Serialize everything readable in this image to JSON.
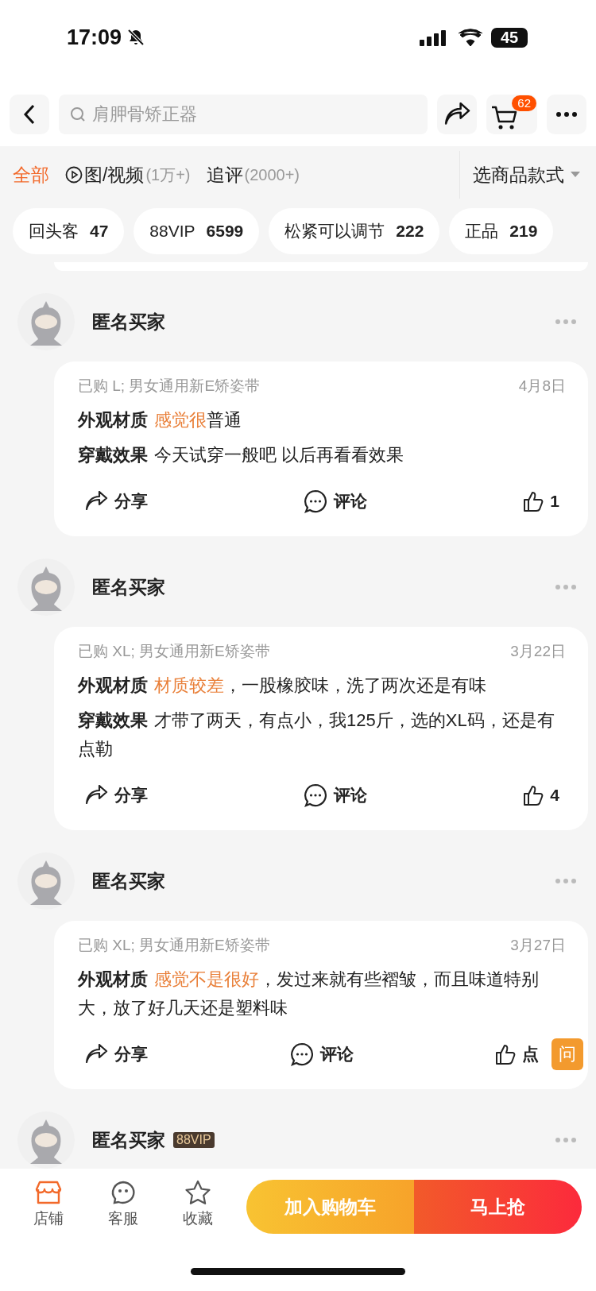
{
  "status_bar": {
    "time": "17:09",
    "battery": "45"
  },
  "nav": {
    "search": {
      "placeholder": "肩胛骨矫正器"
    },
    "cart_badge": "62"
  },
  "filters": {
    "tabs": [
      {
        "label": "全部",
        "selected": true
      },
      {
        "label": "图/视频",
        "count": "(1万+)",
        "selected": false,
        "kind": "media"
      },
      {
        "label": "追评",
        "count": "(2000+)",
        "selected": false
      }
    ],
    "style_picker": "选商品款式"
  },
  "tags": [
    {
      "label": "回头客",
      "count": "47"
    },
    {
      "label": "88VIP",
      "count": "6599"
    },
    {
      "label": "松紧可以调节",
      "count": "222"
    },
    {
      "label": "正品",
      "count": "219"
    }
  ],
  "reviews": [
    {
      "name": "匿名买家",
      "variant": "已购 L; 男女通用新E矫姿带",
      "date": "4月8日",
      "lines": [
        {
          "label": "外观材质",
          "highlight": "感觉很",
          "text": "普通"
        },
        {
          "label": "穿戴效果",
          "text": "今天试穿一般吧 以后再看看效果"
        }
      ],
      "share": "分享",
      "comment": "评论",
      "likes": "1"
    },
    {
      "name": "匿名买家",
      "variant": "已购 XL; 男女通用新E矫姿带",
      "date": "3月22日",
      "lines": [
        {
          "label": "外观材质",
          "highlight": "材质较差",
          "text": "，一股橡胶味，洗了两次还是有味"
        },
        {
          "label": "穿戴效果",
          "text": "才带了两天，有点小，我125斤，选的XL码，还是有点勒"
        }
      ],
      "share": "分享",
      "comment": "评论",
      "likes": "4"
    },
    {
      "name": "匿名买家",
      "variant": "已购 XL; 男女通用新E矫姿带",
      "date": "3月27日",
      "lines": [
        {
          "label": "外观材质",
          "highlight": "感觉不是很好",
          "text": "，发过来就有些褶皱，而且味道特别大，放了好几天还是塑料味"
        }
      ],
      "share": "分享",
      "comment": "评论",
      "likes": "点"
    },
    {
      "name": "匿名买家",
      "badge": "88VIP"
    }
  ],
  "ask_button": "问",
  "bottom_bar": {
    "items": [
      {
        "label": "店铺",
        "kind": "store",
        "selected": true
      },
      {
        "label": "客服",
        "kind": "service",
        "selected": false
      },
      {
        "label": "收藏",
        "kind": "favorite",
        "selected": false
      }
    ],
    "add_to_cart": "加入购物车",
    "buy_now": "马上抢"
  }
}
